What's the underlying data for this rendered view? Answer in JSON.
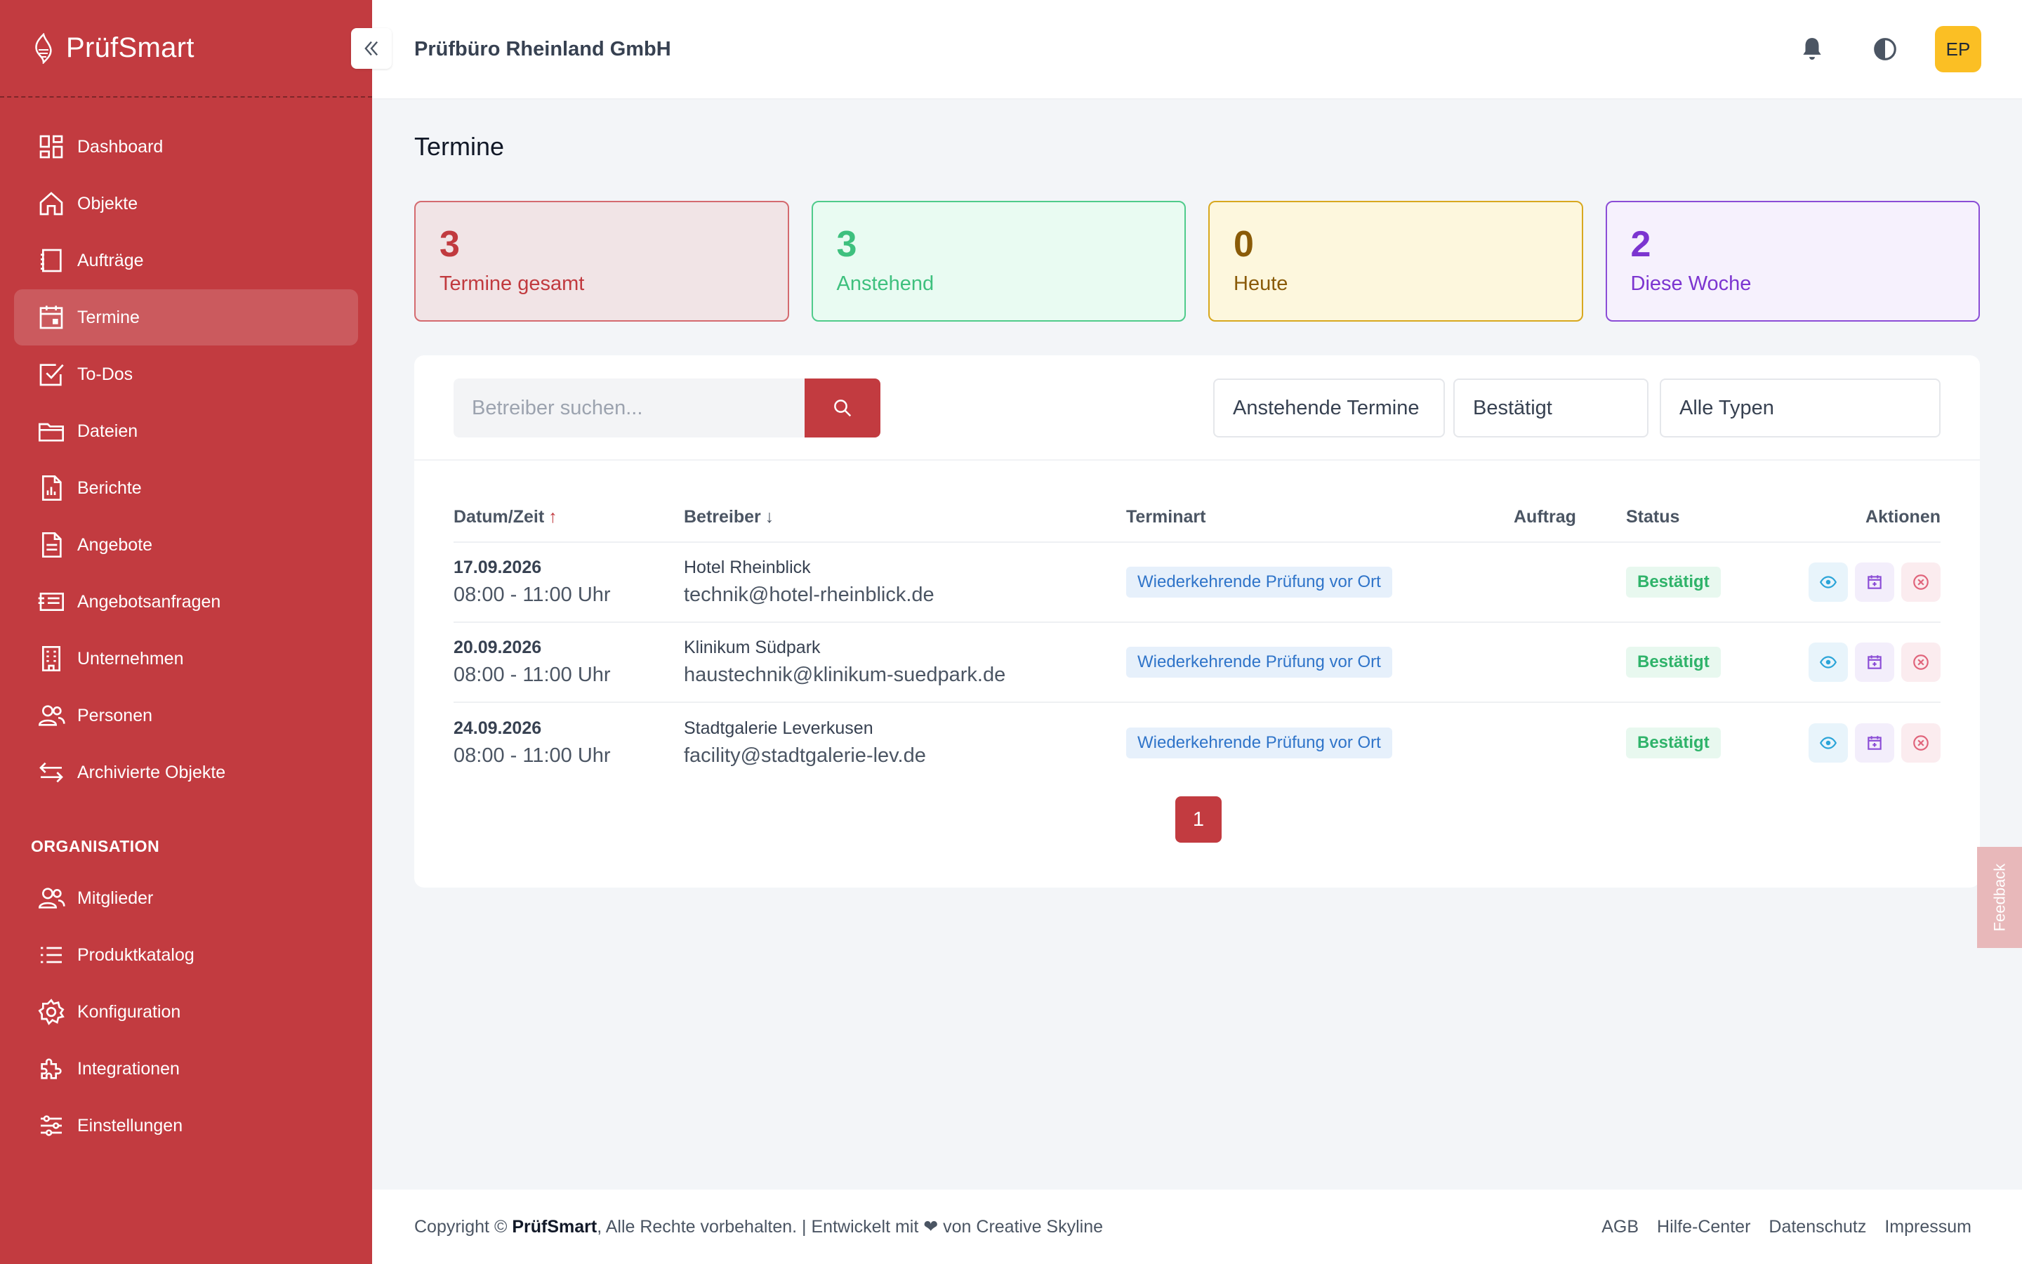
{
  "app": {
    "brand": "PrüfSmart",
    "org_name": "Prüfbüro Rheinland GmbH",
    "avatar_initials": "EP",
    "accent": "#c23b40"
  },
  "sidebar": {
    "items": [
      {
        "label": "Dashboard",
        "icon": "dashboard-icon"
      },
      {
        "label": "Objekte",
        "icon": "home-icon"
      },
      {
        "label": "Aufträge",
        "icon": "clipboard-icon"
      },
      {
        "label": "Termine",
        "icon": "calendar-icon",
        "active": true
      },
      {
        "label": "To-Dos",
        "icon": "checkbox-icon"
      },
      {
        "label": "Dateien",
        "icon": "folder-icon"
      },
      {
        "label": "Berichte",
        "icon": "report-icon"
      },
      {
        "label": "Angebote",
        "icon": "document-icon"
      },
      {
        "label": "Angebotsanfragen",
        "icon": "inbox-icon"
      },
      {
        "label": "Unternehmen",
        "icon": "building-icon"
      },
      {
        "label": "Personen",
        "icon": "users-icon"
      },
      {
        "label": "Archivierte Objekte",
        "icon": "arrows-icon"
      }
    ],
    "org_section_title": "ORGANISATION",
    "org_items": [
      {
        "label": "Mitglieder",
        "icon": "users-icon"
      },
      {
        "label": "Produktkatalog",
        "icon": "list-icon"
      },
      {
        "label": "Konfiguration",
        "icon": "gear-icon"
      },
      {
        "label": "Integrationen",
        "icon": "puzzle-icon"
      },
      {
        "label": "Einstellungen",
        "icon": "sliders-icon"
      }
    ]
  },
  "page": {
    "title": "Termine"
  },
  "stats": [
    {
      "value": "3",
      "label": "Termine gesamt",
      "color": "#c13a3f"
    },
    {
      "value": "3",
      "label": "Anstehend",
      "color": "#3ec07e"
    },
    {
      "value": "0",
      "label": "Heute",
      "color": "#8a5b08"
    },
    {
      "value": "2",
      "label": "Diese Woche",
      "color": "#7c35d0"
    }
  ],
  "filters": {
    "search_placeholder": "Betreiber suchen...",
    "time_filter": "Anstehende Termine",
    "status_filter": "Bestätigt",
    "type_filter": "Alle Typen"
  },
  "table": {
    "headers": {
      "date": "Datum/Zeit",
      "date_sort": "↑",
      "operator": "Betreiber",
      "operator_sort": "↓",
      "type": "Terminart",
      "order": "Auftrag",
      "status": "Status",
      "actions": "Aktionen"
    },
    "rows": [
      {
        "date": "17.09.2026",
        "time": "08:00 - 11:00 Uhr",
        "operator": "Hotel Rheinblick",
        "email": "technik@hotel-rheinblick.de",
        "type": "Wiederkehrende Prüfung vor Ort",
        "order": "",
        "status": "Bestätigt"
      },
      {
        "date": "20.09.2026",
        "time": "08:00 - 11:00 Uhr",
        "operator": "Klinikum Südpark",
        "email": "haustechnik@klinikum-suedpark.de",
        "type": "Wiederkehrende Prüfung vor Ort",
        "order": "",
        "status": "Bestätigt"
      },
      {
        "date": "24.09.2026",
        "time": "08:00 - 11:00 Uhr",
        "operator": "Stadtgalerie Leverkusen",
        "email": "facility@stadtgalerie-lev.de",
        "type": "Wiederkehrende Prüfung vor Ort",
        "order": "",
        "status": "Bestätigt"
      }
    ]
  },
  "pagination": {
    "current": "1"
  },
  "footer": {
    "copyright_prefix": "Copyright ©",
    "brand": "PrüfSmart",
    "copyright_suffix": ", Alle Rechte vorbehalten. | Entwickelt mit ❤ von Creative Skyline",
    "links": [
      "AGB",
      "Hilfe-Center",
      "Datenschutz",
      "Impressum"
    ]
  },
  "feedback_label": "Feedback"
}
